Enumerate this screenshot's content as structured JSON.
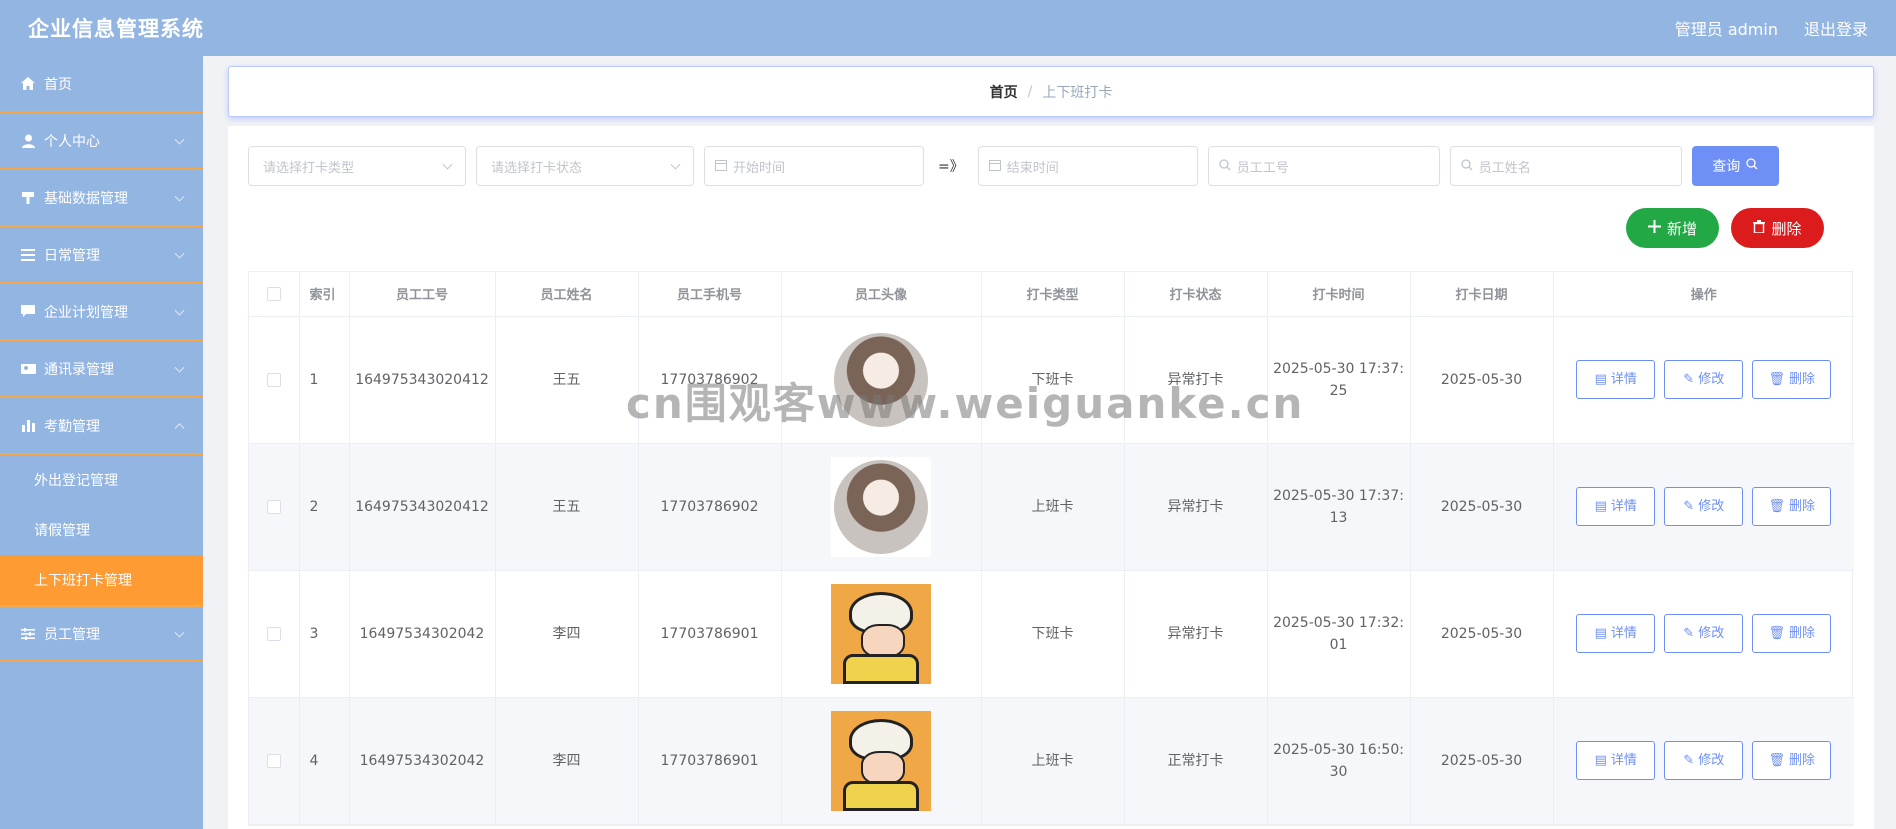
{
  "header": {
    "title": "企业信息管理系统",
    "user": "管理员 admin",
    "logout": "退出登录"
  },
  "sidebar": {
    "items": [
      {
        "label": "首页",
        "icon": "home-icon",
        "expandable": false
      },
      {
        "label": "个人中心",
        "icon": "user-icon",
        "expandable": true
      },
      {
        "label": "基础数据管理",
        "icon": "database-icon",
        "expandable": true
      },
      {
        "label": "日常管理",
        "icon": "list-icon",
        "expandable": true
      },
      {
        "label": "企业计划管理",
        "icon": "chat-icon",
        "expandable": true
      },
      {
        "label": "通讯录管理",
        "icon": "contacts-icon",
        "expandable": true
      },
      {
        "label": "考勤管理",
        "icon": "chart-icon",
        "expandable": true,
        "expanded": true
      }
    ],
    "subitems": [
      {
        "label": "外出登记管理"
      },
      {
        "label": "请假管理"
      },
      {
        "label": "上下班打卡管理",
        "active": true
      }
    ],
    "last_item": {
      "label": "员工管理",
      "icon": "sliders-icon"
    }
  },
  "breadcrumb": {
    "home": "首页",
    "sep": "/",
    "current": "上下班打卡"
  },
  "filters": {
    "type_placeholder": "请选择打卡类型",
    "status_placeholder": "请选择打卡状态",
    "start_placeholder": "开始时间",
    "range_sep": "=》",
    "end_placeholder": "结束时间",
    "empno_placeholder": "员工工号",
    "name_placeholder": "员工姓名",
    "query_label": "查询"
  },
  "actions": {
    "add_label": "新增",
    "delete_label": "删除"
  },
  "table": {
    "headers": [
      "索引",
      "员工工号",
      "员工姓名",
      "员工手机号",
      "员工头像",
      "打卡类型",
      "打卡状态",
      "打卡时间",
      "打卡日期",
      "操作"
    ],
    "rows": [
      {
        "index": "1",
        "empno": "164975343020412",
        "name": "王五",
        "phone": "17703786902",
        "avatar": "woman",
        "type": "下班卡",
        "status": "异常打卡",
        "time_a": "2025-05-30 17:37:",
        "time_b": "25",
        "date": "2025-05-30"
      },
      {
        "index": "2",
        "empno": "164975343020412",
        "name": "王五",
        "phone": "17703786902",
        "avatar": "woman",
        "type": "上班卡",
        "status": "异常打卡",
        "time_a": "2025-05-30 17:37:",
        "time_b": "13",
        "date": "2025-05-30"
      },
      {
        "index": "3",
        "empno": "16497534302042",
        "name": "李四",
        "phone": "17703786901",
        "avatar": "cartoon",
        "type": "下班卡",
        "status": "异常打卡",
        "time_a": "2025-05-30 17:32:",
        "time_b": "01",
        "date": "2025-05-30"
      },
      {
        "index": "4",
        "empno": "16497534302042",
        "name": "李四",
        "phone": "17703786901",
        "avatar": "cartoon",
        "type": "上班卡",
        "status": "正常打卡",
        "time_a": "2025-05-30 16:50:",
        "time_b": "30",
        "date": "2025-05-30"
      }
    ],
    "ops": {
      "detail": "详情",
      "edit": "修改",
      "delete": "删除"
    }
  },
  "watermark": "cn围观客www.weiguanke.cn",
  "colors": {
    "primary": "#6e8ff5",
    "sidebar": "#93b5e1",
    "active": "#fe9b33",
    "add": "#22a845",
    "danger": "#dc1c1c"
  }
}
